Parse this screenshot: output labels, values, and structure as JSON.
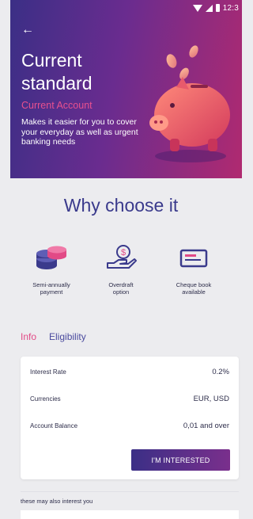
{
  "status": {
    "time": "12:3"
  },
  "header": {
    "title": "Current standard",
    "subtitle": "Current Account",
    "description": "Makes it easier for you to cover your everyday as well as urgent banking needs"
  },
  "why": {
    "heading": "Why choose it"
  },
  "features": [
    {
      "label": "Semi-annually\npayment",
      "icon": "coins-stack-icon"
    },
    {
      "label": "Overdraft\noption",
      "icon": "hand-coin-icon"
    },
    {
      "label": "Cheque book\navailable",
      "icon": "cheque-icon"
    }
  ],
  "tabs": {
    "info": "Info",
    "eligibility": "Eligibility"
  },
  "details": {
    "rows": [
      {
        "key": "Interest Rate",
        "value": "0.2%"
      },
      {
        "key": "Currencies",
        "value": "EUR, USD"
      },
      {
        "key": "Account Balance",
        "value": "0,01 and over"
      }
    ],
    "cta": "I'M INTERESTED"
  },
  "also": "these may also interest you",
  "colors": {
    "accent_pink": "#e24a86",
    "accent_indigo": "#3a3a8c",
    "hero_start": "#3b2f86",
    "hero_end": "#b02a70"
  }
}
